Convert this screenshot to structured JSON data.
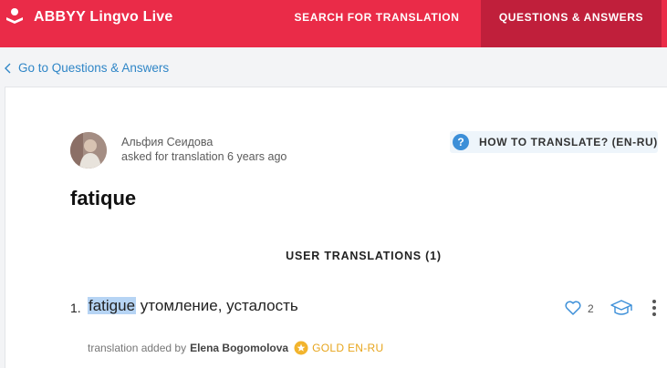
{
  "header": {
    "brand": "ABBYY Lingvo Live",
    "nav_search": "SEARCH FOR TRANSLATION",
    "nav_qa": "QUESTIONS & ANSWERS"
  },
  "back_link": "Go to Questions & Answers",
  "question": {
    "author": "Альфия Сеидова",
    "asked": "asked for translation 6 years ago",
    "badge": "HOW TO TRANSLATE? (EN-RU)",
    "badge_icon": "?",
    "term": "fatique"
  },
  "translations_header": "USER TRANSLATIONS (1)",
  "translations": [
    {
      "number": "1.",
      "word": "fatigue",
      "meaning": "утомление, усталость",
      "likes": "2",
      "added_by_label": "translation added by",
      "added_by": "Elena Bogomolova",
      "status": "GOLD EN-RU"
    }
  ],
  "colors": {
    "header_bg": "#ea2b48",
    "active_tab_bg": "#c01f3b",
    "link": "#2f86c7",
    "badge_icon": "#3c8fd8",
    "gold": "#e7a51c",
    "highlight": "#b6d4f4"
  },
  "icons": {
    "logo": "lingvo-logo-icon",
    "back": "chevron-left-icon",
    "like": "heart-icon",
    "teacher": "graduation-cap-icon",
    "more": "vertical-dots-icon",
    "gold": "star-icon"
  }
}
